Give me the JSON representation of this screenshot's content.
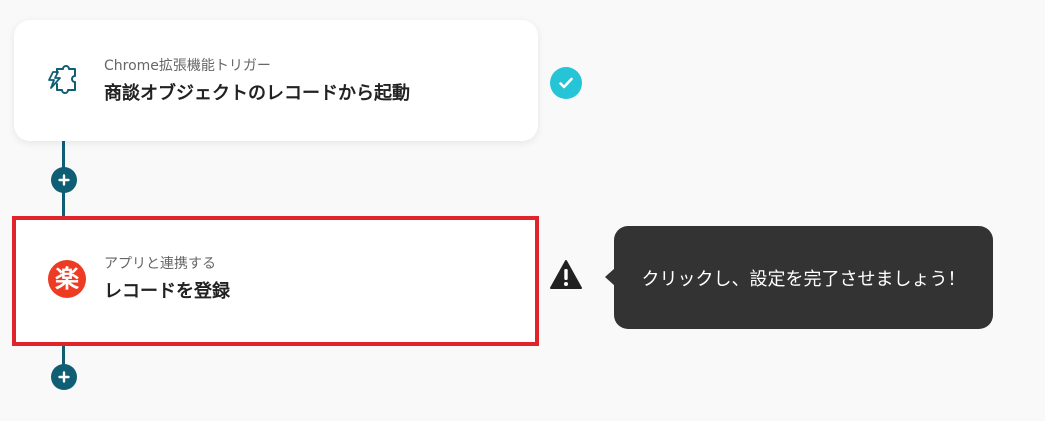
{
  "steps": [
    {
      "subtitle": "Chrome拡張機能トリガー",
      "title": "商談オブジェクトのレコードから起動",
      "icon": "puzzle-lightning-icon",
      "status": "complete"
    },
    {
      "subtitle": "アプリと連携する",
      "title": "レコードを登録",
      "icon_glyph": "楽",
      "icon": "rakuten-app-icon",
      "status": "warning"
    }
  ],
  "tooltip": {
    "message": "クリックし、設定を完了させましょう！"
  },
  "colors": {
    "connector": "#0f5e74",
    "check": "#25c4d6",
    "highlight_border": "#e0242c",
    "rakuten": "#ee3b24",
    "tooltip_bg": "#333333"
  }
}
